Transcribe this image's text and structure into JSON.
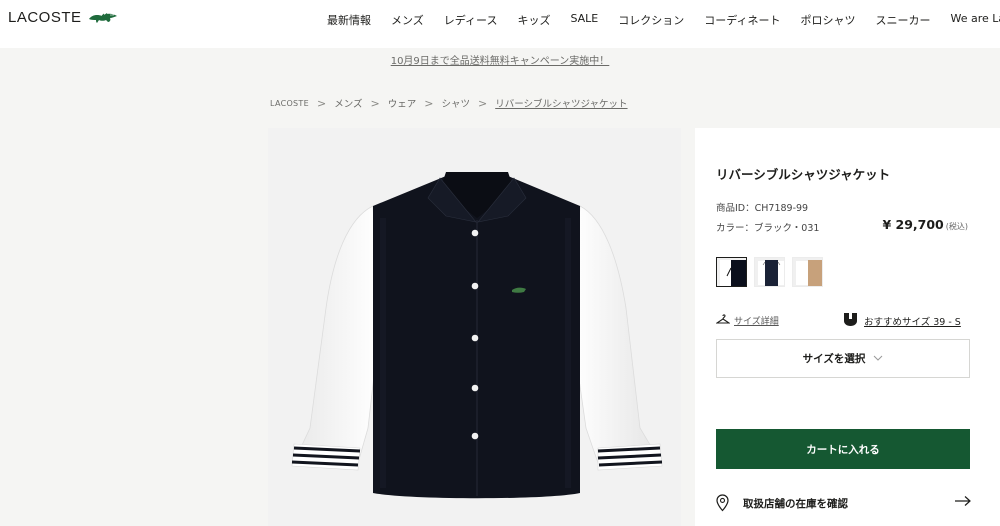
{
  "header": {
    "logo_text": "LACOSTE",
    "logo_icon": "crocodile-icon",
    "nav": [
      "最新情報",
      "メンズ",
      "レディース",
      "キッズ",
      "SALE",
      "コレクション",
      "コーディネート",
      "ポロシャツ",
      "スニーカー",
      "We are Lacoste"
    ]
  },
  "promo": "10月9日まで全品送料無料キャンペーン実施中！",
  "breadcrumb": {
    "items": [
      "LACOSTE",
      "メンズ",
      "ウェア",
      "シャツ"
    ],
    "current": "リバーシブルシャツジャケット",
    "separator": ">"
  },
  "product": {
    "title": "リバーシブルシャツジャケット",
    "id_text": "商品ID：CH7189-99",
    "color_text": "カラー：ブラック・031",
    "price": "¥ 29,700",
    "price_note": "(税込)",
    "swatches": [
      {
        "name": "black-white",
        "colors": [
          "#ffffff",
          "#0b0f1c"
        ]
      },
      {
        "name": "navy-white",
        "colors": [
          "#ffffff",
          "#1a2236"
        ]
      },
      {
        "name": "white-camel",
        "colors": [
          "#ffffff",
          "#c7a17b"
        ]
      }
    ],
    "selected_swatch": 0
  },
  "size": {
    "guide_label": "サイズ詳細",
    "guide_icon": "hanger-icon",
    "recommend_label": "おすすめサイズ 39 - S",
    "recommend_icon": "size-badge-icon",
    "select_label": "サイズを選択",
    "select_icon": "chevron-down-icon"
  },
  "cart": {
    "label": "カートに入れる",
    "color": "#155832"
  },
  "store": {
    "label": "取扱店舗の在庫を確認",
    "icon": "map-pin-icon",
    "arrow_icon": "arrow-right-icon"
  },
  "colors": {
    "brand_green": "#155832",
    "jacket_body": "#10131d",
    "sleeve": "#ffffff"
  }
}
